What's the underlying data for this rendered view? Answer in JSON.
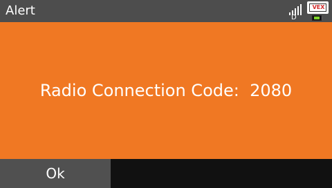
{
  "header": {
    "title": "Alert",
    "signal_icon": "signal-bars-icon",
    "signal_mode": "D",
    "logo_icon": "vex-logo-icon",
    "logo_text": "VEX",
    "battery_icon": "battery-icon",
    "battery_level": 0.8
  },
  "alert": {
    "message": "Radio Connection Code:  2080",
    "background_color": "#f07823"
  },
  "footer": {
    "ok_label": "Ok"
  },
  "colors": {
    "titlebar": "#4d4d4d",
    "button": "#505050",
    "battery": "#7fd32b"
  }
}
